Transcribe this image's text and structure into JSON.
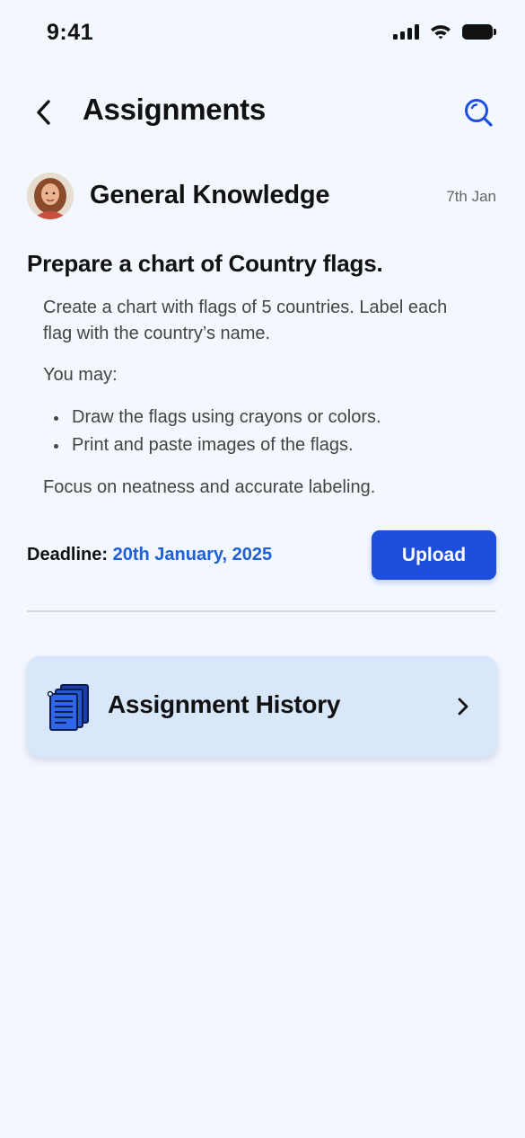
{
  "status_bar": {
    "time": "9:41"
  },
  "header": {
    "title": "Assignments"
  },
  "subject": {
    "name": "General Knowledge",
    "date": "7th Jan"
  },
  "assignment": {
    "title": "Prepare a chart of Country flags.",
    "description": "Create a chart with flags of 5 countries. Label each flag with the country’s name.",
    "intro": "You may:",
    "bullets": [
      "Draw the flags using crayons or colors.",
      "Print and paste images of the flags."
    ],
    "note": "Focus on neatness and accurate labeling."
  },
  "deadline": {
    "label": "Deadline:",
    "date": "20th January, 2025"
  },
  "upload": {
    "label": "Upload"
  },
  "history": {
    "label": "Assignment History"
  },
  "colors": {
    "accent": "#1e4fdc",
    "deadline": "#1f5fd6",
    "card": "#d9e7fb",
    "background": "#f3f7fe"
  },
  "icons": {
    "back": "chevron-left-icon",
    "search": "search-icon",
    "history": "documents-stack-icon",
    "history_chevron": "chevron-right-icon",
    "signal": "cellular-signal-icon",
    "wifi": "wifi-icon",
    "battery": "battery-icon"
  }
}
